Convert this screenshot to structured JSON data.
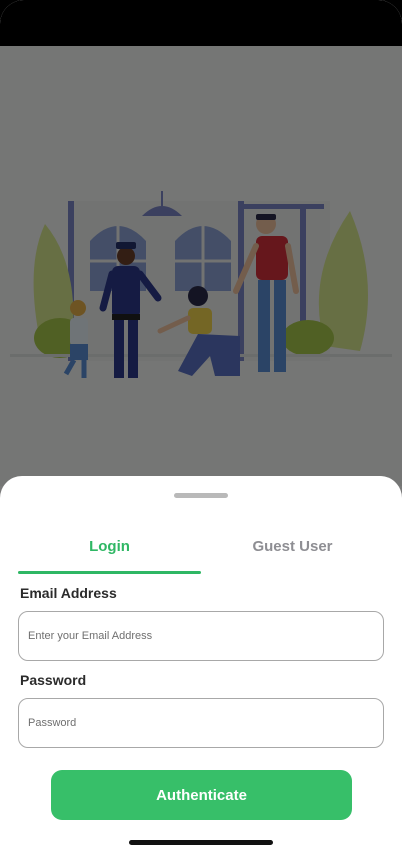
{
  "tabs": [
    {
      "label": "Login",
      "active": true
    },
    {
      "label": "Guest User",
      "active": false
    }
  ],
  "form": {
    "email_label": "Email Address",
    "email_placeholder": "Enter your Email Address",
    "password_label": "Password",
    "password_placeholder": "Password"
  },
  "actions": {
    "authenticate_label": "Authenticate"
  },
  "colors": {
    "accent": "#37bf69",
    "tab_active": "#2fb764",
    "tab_inactive": "#8e8e93"
  },
  "illustration": {
    "icon": "police-family-illustration"
  }
}
